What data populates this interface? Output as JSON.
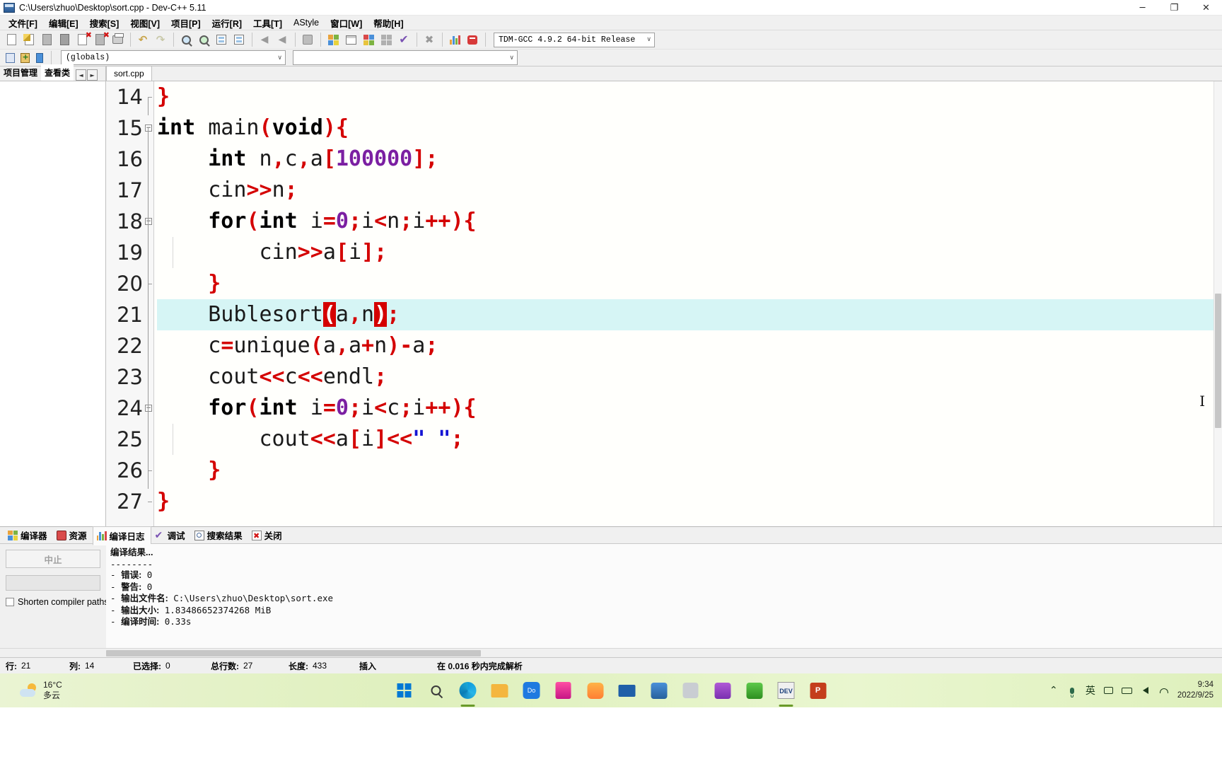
{
  "window": {
    "title": "C:\\Users\\zhuo\\Desktop\\sort.cpp - Dev-C++ 5.11",
    "app_icon": "dev-cpp-icon",
    "minimize": "─",
    "maximize": "❐",
    "close": "✕"
  },
  "menu": [
    {
      "label": "文件[F]",
      "name": "menu-file"
    },
    {
      "label": "编辑[E]",
      "name": "menu-edit"
    },
    {
      "label": "搜索[S]",
      "name": "menu-search"
    },
    {
      "label": "视图[V]",
      "name": "menu-view"
    },
    {
      "label": "项目[P]",
      "name": "menu-project"
    },
    {
      "label": "运行[R]",
      "name": "menu-run"
    },
    {
      "label": "工具[T]",
      "name": "menu-tools"
    },
    {
      "label": "AStyle",
      "name": "menu-astyle"
    },
    {
      "label": "窗口[W]",
      "name": "menu-window"
    },
    {
      "label": "帮助[H]",
      "name": "menu-help"
    }
  ],
  "toolbar": {
    "compiler_select": "TDM-GCC 4.9.2 64-bit Release",
    "caret": "∨",
    "icons": [
      "new-file-icon",
      "open-file-icon",
      "save-icon",
      "save-all-icon",
      "close-file-icon",
      "close-all-icon",
      "print-icon",
      "undo-icon",
      "redo-icon",
      "find-icon",
      "replace-icon",
      "goto-line-icon",
      "indent-icon",
      "back-icon",
      "forward-icon",
      "toggle-panel-icon",
      "compile-icon",
      "run-icon",
      "compile-run-icon",
      "rebuild-icon",
      "syntax-check-icon",
      "stop-execution-icon",
      "profile-icon",
      "debug-icon"
    ],
    "undo_glyph": "↶",
    "redo_glyph": "↷"
  },
  "scope_bar": {
    "globals_value": "(globals)",
    "class_value": "",
    "icons": [
      "class-browser-icon",
      "add-member-icon",
      "goto-declaration-icon"
    ]
  },
  "left_panel": {
    "tabs": [
      {
        "label": "项目管理",
        "name": "tab-project-manager",
        "active": false
      },
      {
        "label": "查看类",
        "name": "tab-class-browser",
        "active": true
      }
    ],
    "nav_prev": "◄",
    "nav_next": "►"
  },
  "editor": {
    "file_tab": "sort.cpp",
    "active_line": 21,
    "first_line": 14,
    "lines": [
      {
        "n": 14,
        "fold": "end",
        "tokens": [
          {
            "t": "pun",
            "s": "}"
          }
        ]
      },
      {
        "n": 15,
        "fold": "open",
        "tokens": [
          {
            "t": "kw",
            "s": "int"
          },
          {
            "t": "id",
            "s": " main"
          },
          {
            "t": "pun",
            "s": "("
          },
          {
            "t": "kw",
            "s": "void"
          },
          {
            "t": "pun",
            "s": ")"
          },
          {
            "t": "pun",
            "s": "{"
          }
        ]
      },
      {
        "n": 16,
        "fold": "",
        "tokens": [
          {
            "t": "id",
            "s": "    "
          },
          {
            "t": "kw",
            "s": "int"
          },
          {
            "t": "id",
            "s": " n"
          },
          {
            "t": "pun",
            "s": ","
          },
          {
            "t": "id",
            "s": "c"
          },
          {
            "t": "pun",
            "s": ","
          },
          {
            "t": "id",
            "s": "a"
          },
          {
            "t": "pun",
            "s": "["
          },
          {
            "t": "num",
            "s": "100000"
          },
          {
            "t": "pun",
            "s": "]"
          },
          {
            "t": "pun",
            "s": ";"
          }
        ]
      },
      {
        "n": 17,
        "fold": "",
        "tokens": [
          {
            "t": "id",
            "s": "    cin"
          },
          {
            "t": "pun",
            "s": ">>"
          },
          {
            "t": "id",
            "s": "n"
          },
          {
            "t": "pun",
            "s": ";"
          }
        ]
      },
      {
        "n": 18,
        "fold": "open",
        "tokens": [
          {
            "t": "id",
            "s": "    "
          },
          {
            "t": "kw",
            "s": "for"
          },
          {
            "t": "pun",
            "s": "("
          },
          {
            "t": "kw",
            "s": "int"
          },
          {
            "t": "id",
            "s": " i"
          },
          {
            "t": "pun",
            "s": "="
          },
          {
            "t": "num",
            "s": "0"
          },
          {
            "t": "pun",
            "s": ";"
          },
          {
            "t": "id",
            "s": "i"
          },
          {
            "t": "pun",
            "s": "<"
          },
          {
            "t": "id",
            "s": "n"
          },
          {
            "t": "pun",
            "s": ";"
          },
          {
            "t": "id",
            "s": "i"
          },
          {
            "t": "pun",
            "s": "++"
          },
          {
            "t": "pun",
            "s": ")"
          },
          {
            "t": "pun",
            "s": "{"
          }
        ]
      },
      {
        "n": 19,
        "fold": "",
        "tokens": [
          {
            "t": "id",
            "s": "        cin"
          },
          {
            "t": "pun",
            "s": ">>"
          },
          {
            "t": "id",
            "s": "a"
          },
          {
            "t": "pun",
            "s": "["
          },
          {
            "t": "id",
            "s": "i"
          },
          {
            "t": "pun",
            "s": "]"
          },
          {
            "t": "pun",
            "s": ";"
          }
        ]
      },
      {
        "n": 20,
        "fold": "end",
        "tokens": [
          {
            "t": "id",
            "s": "    "
          },
          {
            "t": "pun",
            "s": "}"
          }
        ]
      },
      {
        "n": 21,
        "fold": "",
        "tokens": [
          {
            "t": "id",
            "s": "    Bublesort"
          },
          {
            "t": "brk",
            "s": "("
          },
          {
            "t": "id",
            "s": "a"
          },
          {
            "t": "pun",
            "s": ","
          },
          {
            "t": "id",
            "s": "n"
          },
          {
            "t": "brk",
            "s": ")"
          },
          {
            "t": "pun",
            "s": ";"
          }
        ]
      },
      {
        "n": 22,
        "fold": "",
        "tokens": [
          {
            "t": "id",
            "s": "    c"
          },
          {
            "t": "pun",
            "s": "="
          },
          {
            "t": "id",
            "s": "unique"
          },
          {
            "t": "pun",
            "s": "("
          },
          {
            "t": "id",
            "s": "a"
          },
          {
            "t": "pun",
            "s": ","
          },
          {
            "t": "id",
            "s": "a"
          },
          {
            "t": "pun",
            "s": "+"
          },
          {
            "t": "id",
            "s": "n"
          },
          {
            "t": "pun",
            "s": ")"
          },
          {
            "t": "pun",
            "s": "-"
          },
          {
            "t": "id",
            "s": "a"
          },
          {
            "t": "pun",
            "s": ";"
          }
        ]
      },
      {
        "n": 23,
        "fold": "",
        "tokens": [
          {
            "t": "id",
            "s": "    cout"
          },
          {
            "t": "pun",
            "s": "<<"
          },
          {
            "t": "id",
            "s": "c"
          },
          {
            "t": "pun",
            "s": "<<"
          },
          {
            "t": "id",
            "s": "endl"
          },
          {
            "t": "pun",
            "s": ";"
          }
        ]
      },
      {
        "n": 24,
        "fold": "open",
        "tokens": [
          {
            "t": "id",
            "s": "    "
          },
          {
            "t": "kw",
            "s": "for"
          },
          {
            "t": "pun",
            "s": "("
          },
          {
            "t": "kw",
            "s": "int"
          },
          {
            "t": "id",
            "s": " i"
          },
          {
            "t": "pun",
            "s": "="
          },
          {
            "t": "num",
            "s": "0"
          },
          {
            "t": "pun",
            "s": ";"
          },
          {
            "t": "id",
            "s": "i"
          },
          {
            "t": "pun",
            "s": "<"
          },
          {
            "t": "id",
            "s": "c"
          },
          {
            "t": "pun",
            "s": ";"
          },
          {
            "t": "id",
            "s": "i"
          },
          {
            "t": "pun",
            "s": "++"
          },
          {
            "t": "pun",
            "s": ")"
          },
          {
            "t": "pun",
            "s": "{"
          }
        ]
      },
      {
        "n": 25,
        "fold": "",
        "tokens": [
          {
            "t": "id",
            "s": "        cout"
          },
          {
            "t": "pun",
            "s": "<<"
          },
          {
            "t": "id",
            "s": "a"
          },
          {
            "t": "pun",
            "s": "["
          },
          {
            "t": "id",
            "s": "i"
          },
          {
            "t": "pun",
            "s": "]"
          },
          {
            "t": "pun",
            "s": "<<"
          },
          {
            "t": "str",
            "s": "\" \""
          },
          {
            "t": "pun",
            "s": ";"
          }
        ]
      },
      {
        "n": 26,
        "fold": "end",
        "tokens": [
          {
            "t": "id",
            "s": "    "
          },
          {
            "t": "pun",
            "s": "}"
          }
        ]
      },
      {
        "n": 27,
        "fold": "end",
        "tokens": [
          {
            "t": "pun",
            "s": "}"
          }
        ]
      }
    ]
  },
  "bottom_panel": {
    "tabs": [
      {
        "label": "编译器",
        "name": "tab-compiler",
        "icon": "compiler-icon",
        "active": false
      },
      {
        "label": "资源",
        "name": "tab-resources",
        "icon": "resources-icon",
        "active": false
      },
      {
        "label": "编译日志",
        "name": "tab-compile-log",
        "icon": "log-icon",
        "active": true
      },
      {
        "label": "调试",
        "name": "tab-debug",
        "icon": "check-icon",
        "active": false
      },
      {
        "label": "搜索结果",
        "name": "tab-search-results",
        "icon": "magnifier-icon",
        "active": false
      },
      {
        "label": "关闭",
        "name": "tab-close",
        "icon": "close-red-icon",
        "active": false
      }
    ],
    "abort_button": "中止",
    "shorten_label": "Shorten compiler paths",
    "log_lines": [
      "编译结果...",
      "--------",
      "- 错误: 0",
      "- 警告: 0",
      "- 输出文件名: C:\\Users\\zhuo\\Desktop\\sort.exe",
      "- 输出大小: 1.83486652374268 MiB",
      "- 编译时间: 0.33s"
    ]
  },
  "statusbar": {
    "cells": [
      {
        "key": "行:",
        "value": "21",
        "name": "status-line"
      },
      {
        "key": "列:",
        "value": "14",
        "name": "status-col"
      },
      {
        "key": "已选择:",
        "value": "0",
        "name": "status-selected"
      },
      {
        "key": "总行数:",
        "value": "27",
        "name": "status-total-lines"
      },
      {
        "key": "长度:",
        "value": "433",
        "name": "status-length"
      },
      {
        "key": "插入",
        "value": "",
        "name": "status-insert-mode"
      },
      {
        "key": "在 0.016 秒内完成解析",
        "value": "",
        "name": "status-parse-time"
      }
    ]
  },
  "taskbar": {
    "weather_temp": "16°C",
    "weather_desc": "多云",
    "apps": [
      {
        "name": "start-windows-icon"
      },
      {
        "name": "search-icon"
      },
      {
        "name": "edge-icon"
      },
      {
        "name": "file-explorer-icon"
      },
      {
        "name": "dodo-icon"
      },
      {
        "name": "app-pink-icon"
      },
      {
        "name": "app-orange-icon"
      },
      {
        "name": "mail-icon"
      },
      {
        "name": "app-blue-icon"
      },
      {
        "name": "app-grey-icon"
      },
      {
        "name": "store-icon"
      },
      {
        "name": "app-green-icon"
      },
      {
        "name": "devcpp-taskbar-icon"
      },
      {
        "name": "powerpoint-icon"
      }
    ],
    "tray": [
      {
        "glyph": "⌃",
        "name": "show-hidden-icons-icon"
      },
      {
        "glyph": "⬡",
        "name": "microphone-icon"
      },
      {
        "glyph": "英",
        "name": "ime-english-icon"
      },
      {
        "glyph": "⬚",
        "name": "network-monitor-icon"
      },
      {
        "glyph": "▣",
        "name": "battery-icon"
      },
      {
        "glyph": "◁",
        "name": "volume-icon"
      }
    ],
    "clock_time": "9:34",
    "clock_date": "2022/9/25"
  }
}
